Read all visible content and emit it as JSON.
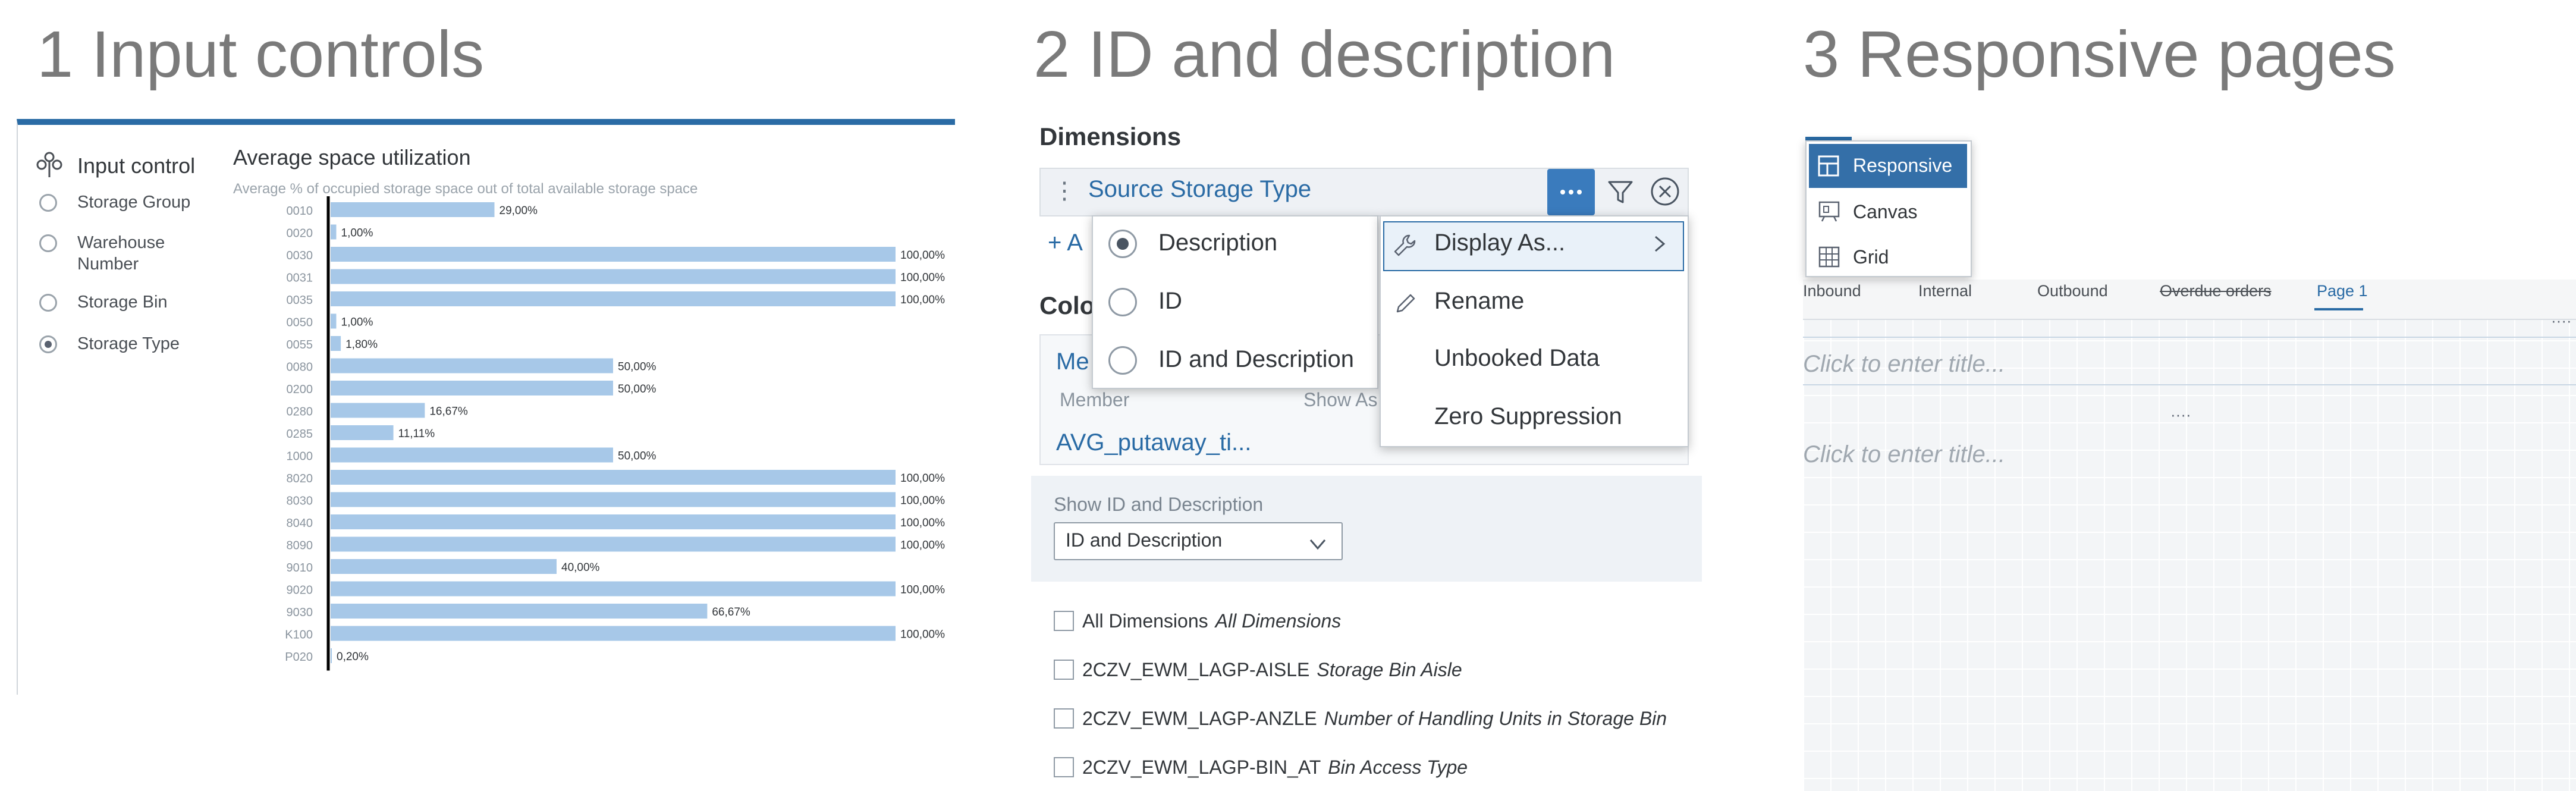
{
  "sections": {
    "s1_title": "1 Input controls",
    "s2_title": "2 ID and description",
    "s3_title": "3 Responsive pages"
  },
  "input_control": {
    "title": "Input control",
    "options": [
      {
        "label": "Storage Group",
        "selected": false
      },
      {
        "label": "Warehouse Number",
        "line1": "Warehouse",
        "line2": "Number",
        "selected": false
      },
      {
        "label": "Storage Bin",
        "selected": false
      },
      {
        "label": "Storage Type",
        "selected": true
      }
    ]
  },
  "chart_data": {
    "type": "bar",
    "orientation": "horizontal",
    "title": "Average space utilization",
    "subtitle": "Average % of occupied storage space out of total available storage space",
    "categories": [
      "0010",
      "0020",
      "0030",
      "0031",
      "0035",
      "0050",
      "0055",
      "0080",
      "0200",
      "0280",
      "0285",
      "1000",
      "8020",
      "8030",
      "8040",
      "8090",
      "9010",
      "9020",
      "9030",
      "K100",
      "P020"
    ],
    "values": [
      29.0,
      1.0,
      100.0,
      100.0,
      100.0,
      1.0,
      1.8,
      50.0,
      50.0,
      16.67,
      11.11,
      50.0,
      100.0,
      100.0,
      100.0,
      100.0,
      40.0,
      100.0,
      66.67,
      100.0,
      0.2
    ],
    "data_labels": [
      "29,00%",
      "1,00%",
      "100,00%",
      "100,00%",
      "100,00%",
      "1,00%",
      "1,80%",
      "50,00%",
      "50,00%",
      "16,67%",
      "11,11%",
      "50,00%",
      "100,00%",
      "100,00%",
      "100,00%",
      "100,00%",
      "40,00%",
      "100,00%",
      "66,67%",
      "100,00%",
      "0,20%"
    ],
    "xlim": [
      0,
      100
    ],
    "bar_color": "#a7c8e8",
    "grid": false
  },
  "dimensions": {
    "heading": "Dimensions",
    "dimension_name": "Source Storage Type",
    "add_fragment": "+ A",
    "colors_fragment": "Colo",
    "measures_fragment": "Me",
    "member_header": "Member",
    "show_as_header": "Show As",
    "member_value": "AVG_putaway_ti..."
  },
  "display_popup": {
    "options": [
      {
        "label": "Description",
        "selected": true
      },
      {
        "label": "ID",
        "selected": false
      },
      {
        "label": "ID and Description",
        "selected": false
      }
    ]
  },
  "context_menu": {
    "items": [
      "Display As...",
      "Rename",
      "Unbooked Data",
      "Zero Suppression"
    ]
  },
  "id_description": {
    "label": "Show ID and Description",
    "selected": "ID and Description"
  },
  "dimension_list": [
    {
      "id": "All Dimensions",
      "desc": "All Dimensions"
    },
    {
      "id": "2CZV_EWM_LAGP-AISLE",
      "desc": "Storage Bin Aisle"
    },
    {
      "id": "2CZV_EWM_LAGP-ANZLE",
      "desc": "Number of Handling Units in Storage Bin"
    },
    {
      "id": "2CZV_EWM_LAGP-BIN_AT",
      "desc": "Bin Access Type"
    }
  ],
  "layout_menu": {
    "items": [
      {
        "label": "Responsive",
        "icon": "responsive-layout-icon",
        "active": true
      },
      {
        "label": "Canvas",
        "icon": "canvas-icon",
        "active": false
      },
      {
        "label": "Grid",
        "icon": "grid-icon",
        "active": false
      }
    ]
  },
  "page_tabs": [
    "Inbound",
    "Internal",
    "Outbound",
    "Overdue orders",
    "Page 1"
  ],
  "placeholders": {
    "title1": "Click to enter title...",
    "title2": "Click to enter title..."
  },
  "colors": {
    "accent": "#2a6ba5",
    "button_active": "#3a7bbd",
    "title_gray": "#7a7a7a"
  }
}
